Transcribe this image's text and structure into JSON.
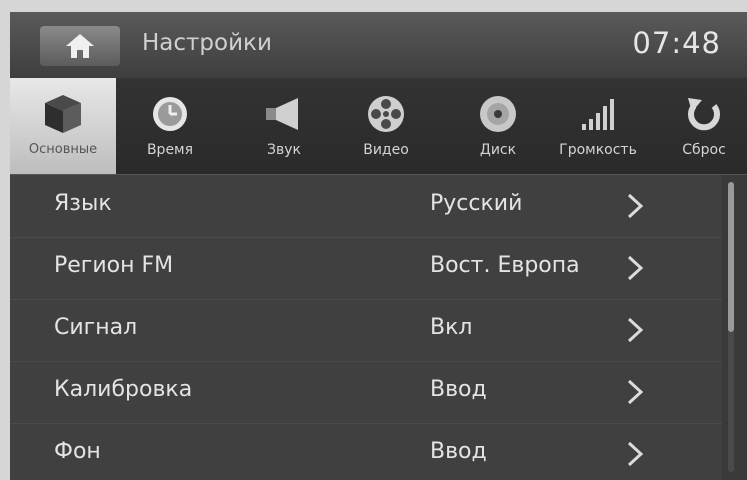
{
  "header": {
    "title": "Настройки",
    "clock": "07:48"
  },
  "tabs": [
    {
      "label": "Основные",
      "icon": "cube-icon",
      "active": true
    },
    {
      "label": "Время",
      "icon": "clock-icon"
    },
    {
      "label": "Звук",
      "icon": "speaker-icon"
    },
    {
      "label": "Видео",
      "icon": "film-reel-icon"
    },
    {
      "label": "Диск",
      "icon": "disc-icon"
    },
    {
      "label": "Громкость",
      "icon": "volume-bars-icon"
    },
    {
      "label": "Сброс",
      "icon": "reset-icon"
    }
  ],
  "settings": [
    {
      "label": "Язык",
      "value": "Русский"
    },
    {
      "label": "Регион FM",
      "value": "Вост. Европа"
    },
    {
      "label": "Сигнал",
      "value": "Вкл"
    },
    {
      "label": "Калибровка",
      "value": "Ввод"
    },
    {
      "label": "Фон",
      "value": "Ввод"
    }
  ],
  "colors": {
    "background": "#3a3a3a",
    "active_tab": "#d8d8d8",
    "text": "#e4e4e4"
  }
}
